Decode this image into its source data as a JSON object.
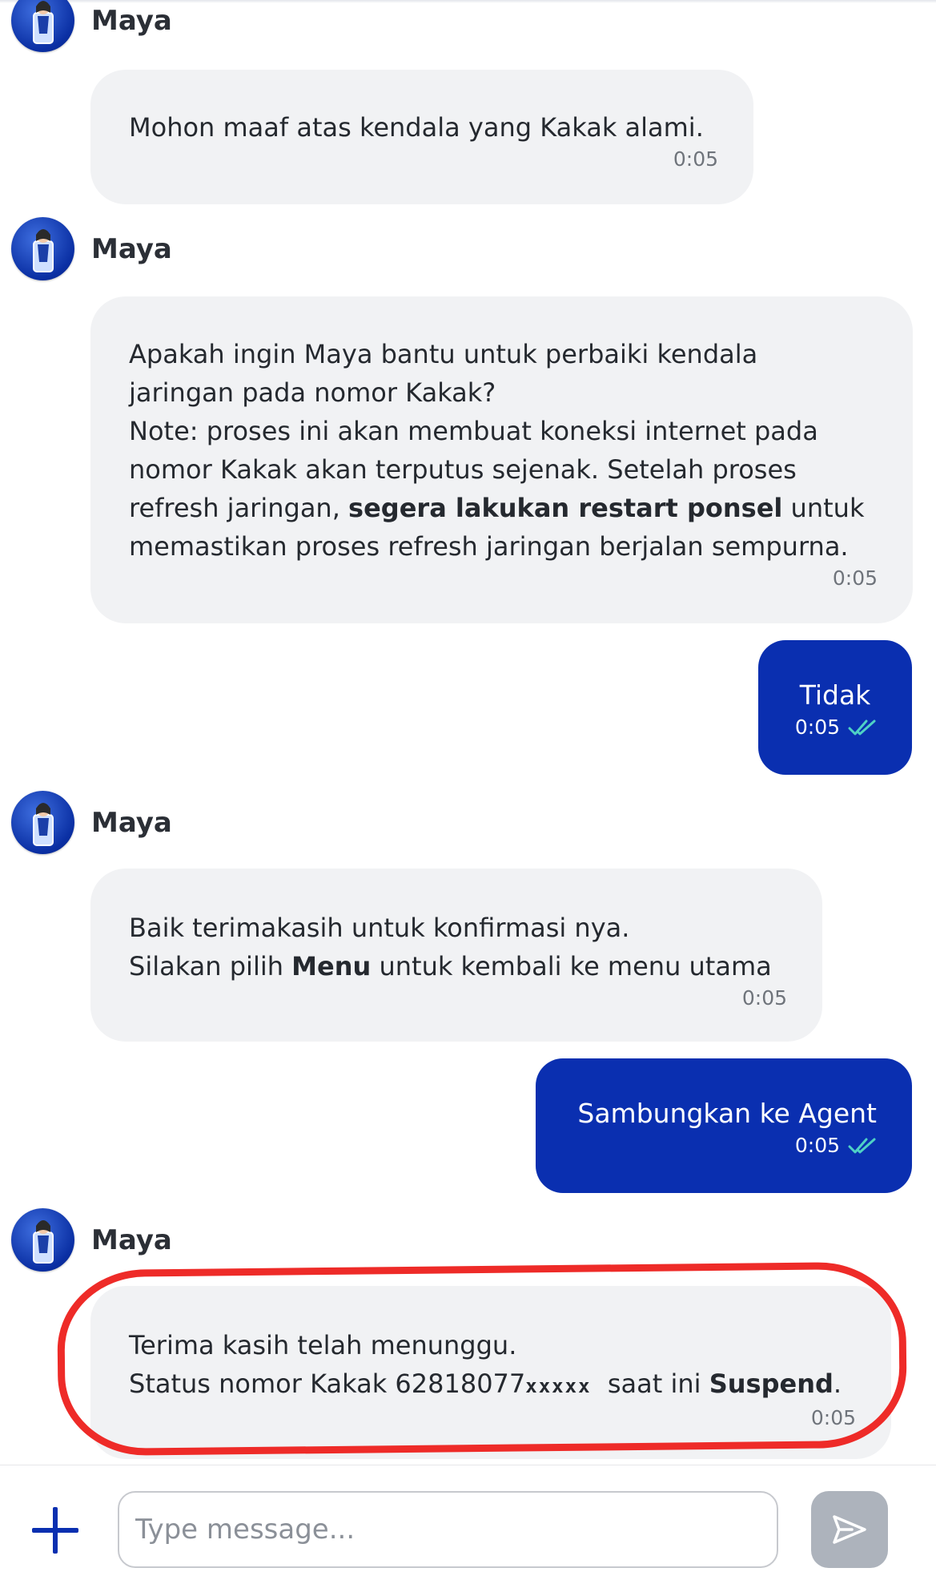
{
  "colors": {
    "outgoing_bubble": "#0a2fb0",
    "incoming_bubble": "#f1f2f4",
    "highlight_annotation": "#ee2b28",
    "read_check": "#4fd1c5",
    "send_button_disabled": "#adb3bc"
  },
  "icons": {
    "avatar": "maya-bot-avatar-icon",
    "read_status": "double-check-icon",
    "attach": "plus-icon",
    "send": "send-arrow-icon"
  },
  "messages": [
    {
      "type": "incoming",
      "sender": "Maya",
      "text": "Mohon maaf atas kendala yang Kakak alami.",
      "time": "0:05"
    },
    {
      "type": "incoming",
      "sender": "Maya",
      "line1": "Apakah ingin Maya bantu untuk perbaiki kendala",
      "line2": "jaringan pada nomor Kakak?",
      "line3": "Note: proses ini akan membuat koneksi internet pada",
      "line4": "nomor Kakak akan terputus sejenak. Setelah proses",
      "line5_pre": "refresh jaringan, ",
      "line5_bold": "segera lakukan restart ponsel",
      "line5_post": " untuk",
      "line6": "memastikan proses refresh jaringan berjalan sempurna.",
      "time": "0:05"
    },
    {
      "type": "outgoing",
      "text": "Tidak",
      "time": "0:05"
    },
    {
      "type": "incoming",
      "sender": "Maya",
      "line1": "Baik terimakasih untuk konfirmasi nya.",
      "line2_pre": "Silakan pilih ",
      "line2_bold": "Menu",
      "line2_post": " untuk kembali ke menu utama",
      "time": "0:05"
    },
    {
      "type": "outgoing",
      "text": "Sambungkan ke Agent",
      "time": "0:05"
    },
    {
      "type": "incoming",
      "sender": "Maya",
      "line1": "Terima kasih telah menunggu.",
      "line2_pre": "Status nomor Kakak 62818077",
      "line2_mask": "xxxxx",
      "line2_mid": "  saat ini ",
      "line2_bold": "Suspend",
      "line2_post": ".",
      "time": "0:05"
    }
  ],
  "composer": {
    "placeholder": "Type message..."
  }
}
